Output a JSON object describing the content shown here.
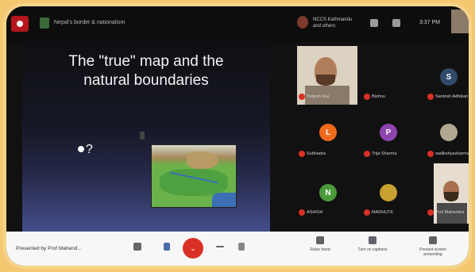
{
  "meeting": {
    "title": "Nepal's border & nationalism",
    "org_name": "NCCS Kathmandu and others",
    "clock": "3:37 PM"
  },
  "slide": {
    "title_line1": "The \"true\" map and the",
    "title_line2": "natural boundaries",
    "bullet_text": "?"
  },
  "participants": [
    {
      "name": "Yogesh Raj",
      "type": "video"
    },
    {
      "name": "Bishnu",
      "type": "avatar",
      "initial": "",
      "color": "#6b6b6b"
    },
    {
      "name": "Santosh Adhikari",
      "type": "avatar",
      "initial": "S",
      "color": "#2f4a6a"
    },
    {
      "name": "Subhadra",
      "type": "avatar",
      "initial": "L",
      "color": "#f06a1c"
    },
    {
      "name": "Trija Sharma",
      "type": "avatar",
      "initial": "P",
      "color": "#8e44ad"
    },
    {
      "name": "sadikshyasharma",
      "type": "avatar",
      "initial": "",
      "color": "#b0a890"
    },
    {
      "name": "ASHISH",
      "type": "avatar",
      "initial": "N",
      "color": "#4a9a3a"
    },
    {
      "name": "MADHUTE",
      "type": "avatar",
      "initial": "",
      "color": "#c8a030"
    },
    {
      "name": "Prof Mahendra",
      "type": "video"
    }
  ],
  "toolbar": {
    "presenting": "Presented by Prof Mahend...",
    "end_call": "⌄",
    "raise_hand": "Raise hand",
    "turn_on_captions": "Turn on captions",
    "present_now": "Present screen presenting"
  }
}
